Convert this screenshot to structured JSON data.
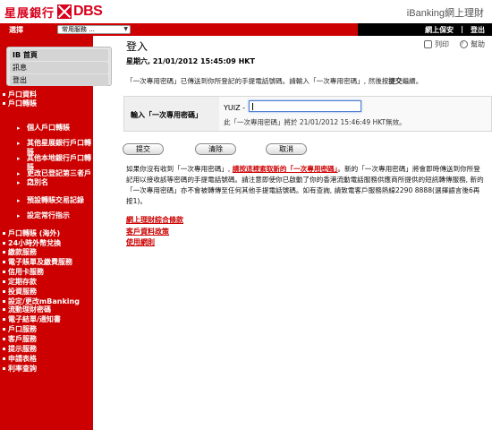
{
  "header": {
    "logo_cn": "星展銀行",
    "logo_en": "DBS",
    "brand": "iBanking網上理財"
  },
  "topbar": {
    "select_label": "選擇",
    "select_value": "常用服務 ...",
    "links": [
      "網上保安",
      "登出"
    ]
  },
  "sidebar": {
    "top_items": [
      "IB 首頁",
      "訊息",
      "登出"
    ],
    "nav": [
      "戶口資料",
      "戶口轉賬",
      "戶口轉賬 (海外)",
      "24小時外幣兌換",
      "繳款服務",
      "電子賬單及繳費服務",
      "信用卡服務",
      "定期存款",
      "投資服務",
      "設定/更改mBanking",
      "流動理財密碼",
      "電子結單/通知書",
      "戶口服務",
      "客戶服務",
      "提示服務",
      "申請表格",
      "利率查詢"
    ],
    "sub": [
      "個人戶口轉賬",
      "其他星展銀行戶口轉賬",
      "其他本地銀行戶口轉賬",
      "更改已登記第三者戶口",
      "之別名",
      "預設轉賬交易記錄",
      "設定常行指示"
    ]
  },
  "main": {
    "title": "登入",
    "print_label": "列印",
    "help_label": "幫助",
    "datetime": "星期六, 21/01/2012 15:45:09 HKT",
    "notice_pre": "「一次專用密碼」已傳送到你所登記的手提電話號碼。請輸入「一次專用密碼」, 然後按",
    "notice_bold": "提交",
    "notice_post": "繼續。",
    "form_label": "輸入「一次專用密碼」",
    "prefix": "YUIZ -",
    "password_value": "",
    "expiry": "此「一次專用密碼」將於 21/01/2012 15:46:49 HKT無效。",
    "buttons": [
      "提交",
      "清除",
      "取消"
    ],
    "para_line1_pre": "如果你沒有收到「一次專用密碼」, ",
    "para_link": "請按這裡索取新的「一次專用密碼」",
    "para_line1_post": "。新的「一次專用密碼」將會即時傳送到你所登",
    "para_line2": "記用以接收該等密碼的手提電話號碼。請注意即使你已啟動了你的香港流動電話服務供應商所提供的短訊轉傳服務, 新的",
    "para_line3": "「一次專用密碼」亦不會被轉傳至任何其他手提電話號碼。如有查詢, 請致電客戶服務熱線2290 8888(選擇語言後6再",
    "para_line4": "按1)。",
    "footer_links": [
      "網上理財綜合條款",
      "客戶資料政策",
      "使用網則"
    ]
  }
}
